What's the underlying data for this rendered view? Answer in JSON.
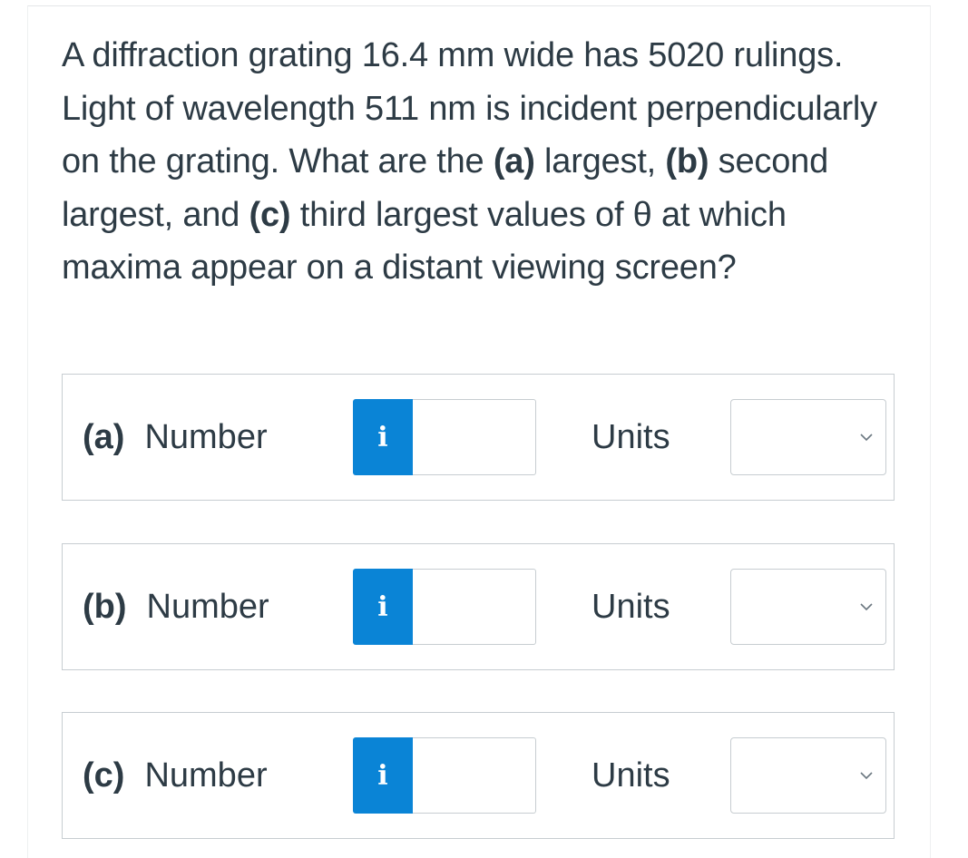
{
  "question": {
    "text_html": "A diffraction grating 16.4 mm wide has 5020 rulings. Light of wavelength 511 nm is incident perpendicularly on the grating. What are the <b>(a)</b> largest, <b>(b)</b> second largest, and <b>(c)</b> third largest values of θ at which maxima appear on a distant viewing screen?"
  },
  "answers": [
    {
      "letter": "(a)",
      "label": "Number",
      "info": "i",
      "value": "",
      "units_label": "Units",
      "units_value": ""
    },
    {
      "letter": "(b)",
      "label": "Number",
      "info": "i",
      "value": "",
      "units_label": "Units",
      "units_value": ""
    },
    {
      "letter": "(c)",
      "label": "Number",
      "info": "i",
      "value": "",
      "units_label": "Units",
      "units_value": ""
    }
  ],
  "colors": {
    "accent": "#0a84d6",
    "text": "#2d3b45",
    "border": "#c7cdd1"
  },
  "icons": {
    "info": "info-icon",
    "dropdown": "chevron-down-icon"
  }
}
